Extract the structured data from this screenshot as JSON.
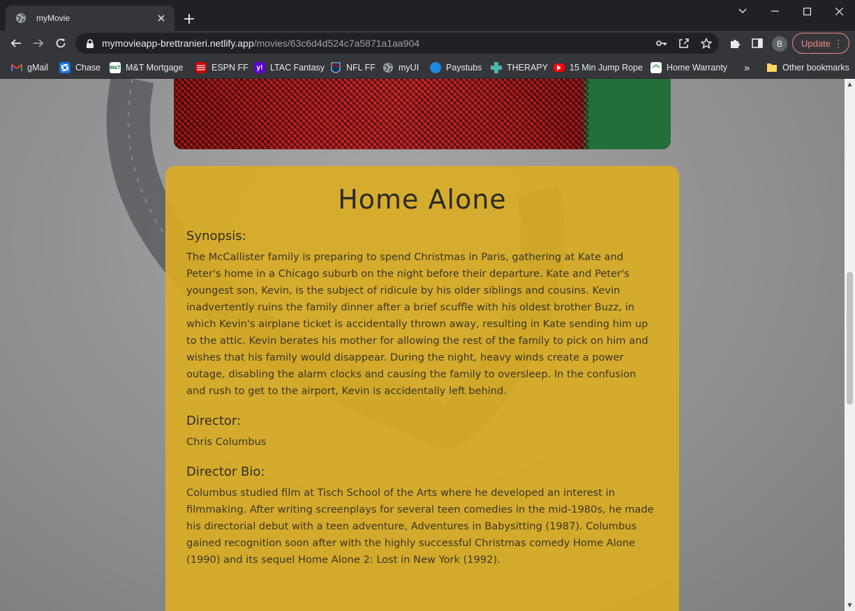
{
  "browser": {
    "tab": {
      "title": "myMovie"
    },
    "url": {
      "host": "mymovieapp-brettranieri.netlify.app",
      "path": "/movies/63c6d4d524c7a5871a1aa904"
    },
    "profile_initial": "B",
    "update_label": "Update",
    "bookmarks": [
      {
        "label": "gMail",
        "icon": "gmail-icon",
        "color": "#ea4335"
      },
      {
        "label": "Chase",
        "icon": "chase-icon",
        "color": "#1a73e8"
      },
      {
        "label": "M&T Mortgage",
        "icon": "mt-icon",
        "color": "#ffffff"
      },
      {
        "label": "ESPN FF",
        "icon": "espn-icon",
        "color": "#d00"
      },
      {
        "label": "LTAC Fantasy",
        "icon": "yahoo-icon",
        "color": "#6001d2"
      },
      {
        "label": "NFL FF",
        "icon": "nfl-icon",
        "color": "#013369"
      },
      {
        "label": "myUI",
        "icon": "globe-icon",
        "color": "#9aa0a6"
      },
      {
        "label": "Paystubs",
        "icon": "paystubs-icon",
        "color": "#1e88e5"
      },
      {
        "label": "THERAPY",
        "icon": "therapy-icon",
        "color": "#4db6ac"
      },
      {
        "label": "15 Min Jump Rope",
        "icon": "youtube-icon",
        "color": "#ff0000"
      },
      {
        "label": "Home Warranty",
        "icon": "home-warranty-icon",
        "color": "#ffffff"
      }
    ],
    "overflow_label": "»",
    "other_bookmarks": "Other bookmarks"
  },
  "movie": {
    "title": "Home Alone",
    "synopsis_heading": "Synopsis:",
    "synopsis": "The McCallister family is preparing to spend Christmas in Paris, gathering at Kate and Peter's home in a Chicago suburb on the night before their departure. Kate and Peter's youngest son, Kevin, is the subject of ridicule by his older siblings and cousins. Kevin inadvertently ruins the family dinner after a brief scuffle with his oldest brother Buzz, in which Kevin's airplane ticket is accidentally thrown away, resulting in Kate sending him up to the attic. Kevin berates his mother for allowing the rest of the family to pick on him and wishes that his family would disappear. During the night, heavy winds create a power outage, disabling the alarm clocks and causing the family to oversleep. In the confusion and rush to get to the airport, Kevin is accidentally left behind.",
    "director_heading": "Director:",
    "director": "Chris Columbus",
    "director_bio_heading": "Director Bio:",
    "director_bio": "Columbus studied film at Tisch School of the Arts where he developed an interest in filmmaking. After writing screenplays for several teen comedies in the mid-1980s, he made his directorial debut with a teen adventure, Adventures in Babysitting (1987). Columbus gained recognition soon after with the highly successful Christmas comedy Home Alone (1990) and its sequel Home Alone 2: Lost in New York (1992)."
  }
}
